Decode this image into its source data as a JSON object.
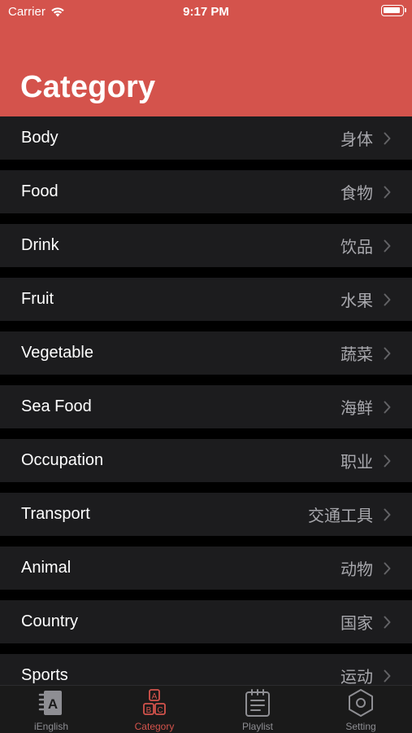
{
  "status_bar": {
    "carrier": "Carrier",
    "time": "9:17 PM"
  },
  "header": {
    "title": "Category",
    "background_color": "#d4534c"
  },
  "categories": [
    {
      "label": "Body",
      "zh": "身体"
    },
    {
      "label": "Food",
      "zh": "食物"
    },
    {
      "label": "Drink",
      "zh": "饮品"
    },
    {
      "label": "Fruit",
      "zh": "水果"
    },
    {
      "label": "Vegetable",
      "zh": "蔬菜"
    },
    {
      "label": "Sea Food",
      "zh": "海鲜"
    },
    {
      "label": "Occupation",
      "zh": "职业"
    },
    {
      "label": "Transport",
      "zh": "交通工具"
    },
    {
      "label": "Animal",
      "zh": "动物"
    },
    {
      "label": "Country",
      "zh": "国家"
    },
    {
      "label": "Sports",
      "zh": "运动"
    }
  ],
  "tabbar": {
    "active_tab": "Category",
    "active_color": "#d4534c",
    "tabs": [
      {
        "label": "iEnglish",
        "icon": "english-book-icon"
      },
      {
        "label": "Category",
        "icon": "abc-blocks-icon"
      },
      {
        "label": "Playlist",
        "icon": "notepad-icon"
      },
      {
        "label": "Setting",
        "icon": "hexagon-gear-icon"
      }
    ]
  }
}
